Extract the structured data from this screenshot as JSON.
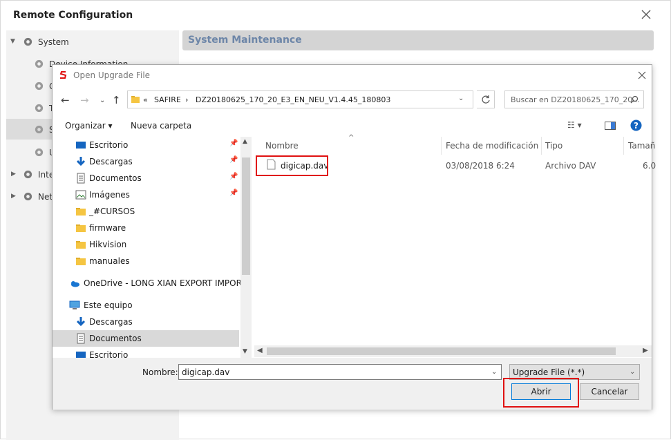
{
  "outer": {
    "title": "Remote Configuration",
    "section_title": "System Maintenance",
    "tree": [
      {
        "label": "System",
        "level": 0,
        "expanded": true
      },
      {
        "label": "Device Information",
        "level": 1
      },
      {
        "label": "G",
        "level": 1
      },
      {
        "label": "T",
        "level": 1
      },
      {
        "label": "S",
        "level": 1,
        "selected": true
      },
      {
        "label": "U",
        "level": 1
      },
      {
        "label": "Inte",
        "level": 0
      },
      {
        "label": "Netv",
        "level": 0
      }
    ]
  },
  "dialog": {
    "title": "Open Upgrade File",
    "address": {
      "chevrons": "«",
      "crumb1": "SAFIRE",
      "sep": "›",
      "crumb2": "DZ20180625_170_20_E3_EN_NEU_V1.4.45_180803"
    },
    "search_placeholder": "Buscar en DZ20180625_170_20...",
    "toolbar": {
      "organize": "Organizar",
      "new_folder": "Nueva carpeta"
    },
    "nav_items": [
      {
        "label": "Escritorio",
        "icon": "desktop-icon",
        "pinned": true
      },
      {
        "label": "Descargas",
        "icon": "download-icon",
        "pinned": true
      },
      {
        "label": "Documentos",
        "icon": "document-icon",
        "pinned": true
      },
      {
        "label": "Imágenes",
        "icon": "image-icon",
        "pinned": true
      },
      {
        "label": "_#CURSOS",
        "icon": "folder-icon"
      },
      {
        "label": "firmware",
        "icon": "folder-icon"
      },
      {
        "label": "Hikvision",
        "icon": "folder-icon"
      },
      {
        "label": "manuales",
        "icon": "folder-icon"
      },
      {
        "label": "OneDrive - LONG XIAN EXPORT IMPORT, SI",
        "icon": "cloud-icon"
      },
      {
        "label": "Este equipo",
        "icon": "computer-icon"
      },
      {
        "label": "Descargas",
        "icon": "download-icon"
      },
      {
        "label": "Documentos",
        "icon": "document-icon",
        "selected": true
      },
      {
        "label": "Escritorio",
        "icon": "desktop-icon"
      }
    ],
    "columns": {
      "name": "Nombre",
      "modified": "Fecha de modificación",
      "type": "Tipo",
      "size": "Tamañ"
    },
    "files": [
      {
        "name": "digicap.dav",
        "modified": "03/08/2018 6:24",
        "type": "Archivo DAV",
        "size": "6.0"
      }
    ],
    "bottom": {
      "name_label": "Nombre:",
      "name_value": "digicap.dav",
      "filter_value": "Upgrade File (*.*)",
      "open_label": "Abrir",
      "cancel_label": "Cancelar"
    }
  },
  "colors": {
    "highlight": "#e01010",
    "header_text": "#6d86a8",
    "folder": "#f5c542"
  }
}
